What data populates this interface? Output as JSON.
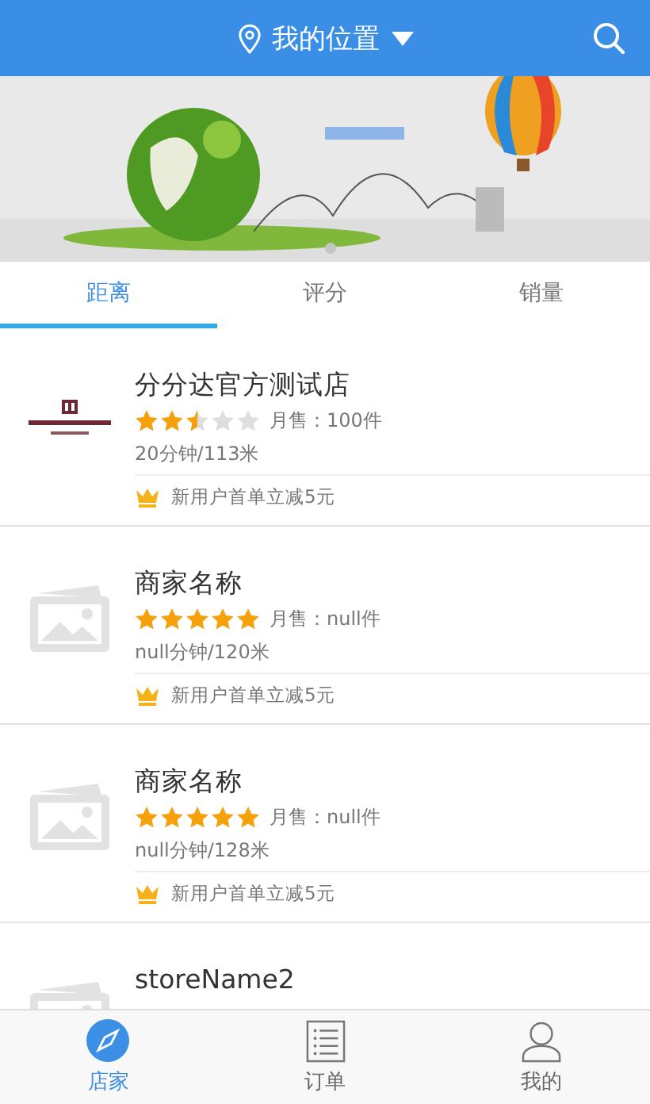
{
  "header": {
    "title": "我的位置"
  },
  "tabs": [
    {
      "label": "距离",
      "selected": true
    },
    {
      "label": "评分",
      "selected": false
    },
    {
      "label": "销量",
      "selected": false
    }
  ],
  "stores": [
    {
      "kind": "brand",
      "name": "分分达官方测试店",
      "stars": 2.5,
      "sales": "月售：100件",
      "distance": "20分钟/113米",
      "promo": "新用户首单立减5元"
    },
    {
      "kind": "placeholder",
      "name": "商家名称",
      "stars": 5,
      "sales": "月售：null件",
      "distance": "null分钟/120米",
      "promo": "新用户首单立减5元"
    },
    {
      "kind": "placeholder",
      "name": "商家名称",
      "stars": 5,
      "sales": "月售：null件",
      "distance": "null分钟/128米",
      "promo": "新用户首单立减5元"
    },
    {
      "kind": "placeholder",
      "name": "storeName2"
    }
  ],
  "nav": [
    {
      "label": "店家",
      "selected": true
    },
    {
      "label": "订单",
      "selected": false
    },
    {
      "label": "我的",
      "selected": false
    }
  ]
}
